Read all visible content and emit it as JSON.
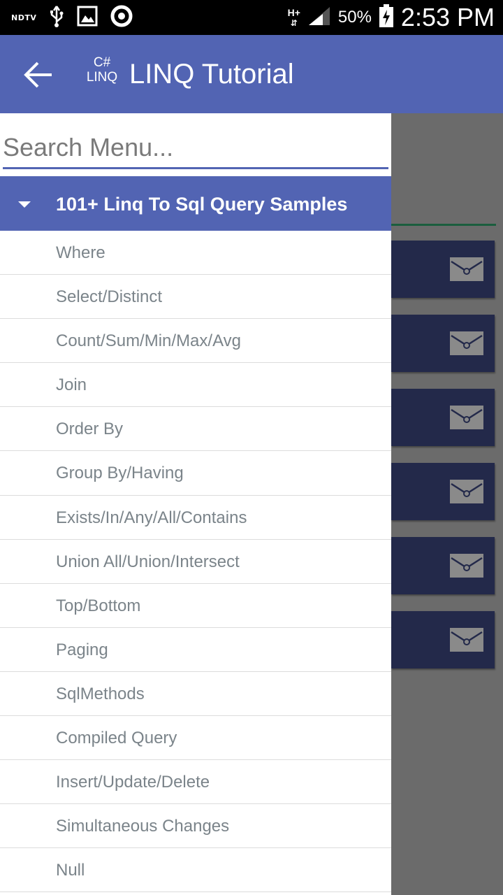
{
  "status_bar": {
    "left_label": "NDTV",
    "network": "H+",
    "battery": "50%",
    "time": "2:53 PM",
    "icons": [
      "usb-icon",
      "image-icon",
      "sync-icon",
      "signal-icon",
      "battery-charging-icon"
    ]
  },
  "app_bar": {
    "logo_top": "C#",
    "logo_bottom": "LINQ",
    "title": "LINQ Tutorial",
    "back_icon": "arrow-back-icon",
    "color": "#5264b3"
  },
  "drawer": {
    "search_placeholder": "Search Menu...",
    "section_title": "101+ Linq To Sql Query Samples",
    "items": [
      {
        "label": "Where"
      },
      {
        "label": "Select/Distinct"
      },
      {
        "label": "Count/Sum/Min/Max/Avg"
      },
      {
        "label": "Join"
      },
      {
        "label": "Order By"
      },
      {
        "label": "Group By/Having"
      },
      {
        "label": "Exists/In/Any/All/Contains"
      },
      {
        "label": "Union All/Union/Intersect"
      },
      {
        "label": "Top/Bottom"
      },
      {
        "label": "Paging"
      },
      {
        "label": "SqlMethods"
      },
      {
        "label": "Compiled Query"
      },
      {
        "label": "Insert/Update/Delete"
      },
      {
        "label": "Simultaneous Changes"
      },
      {
        "label": "Null"
      }
    ]
  },
  "colors": {
    "accent": "#5264b3",
    "card": "#23294a",
    "scrim": "#6b6b6b",
    "item_text": "#7b848a"
  }
}
